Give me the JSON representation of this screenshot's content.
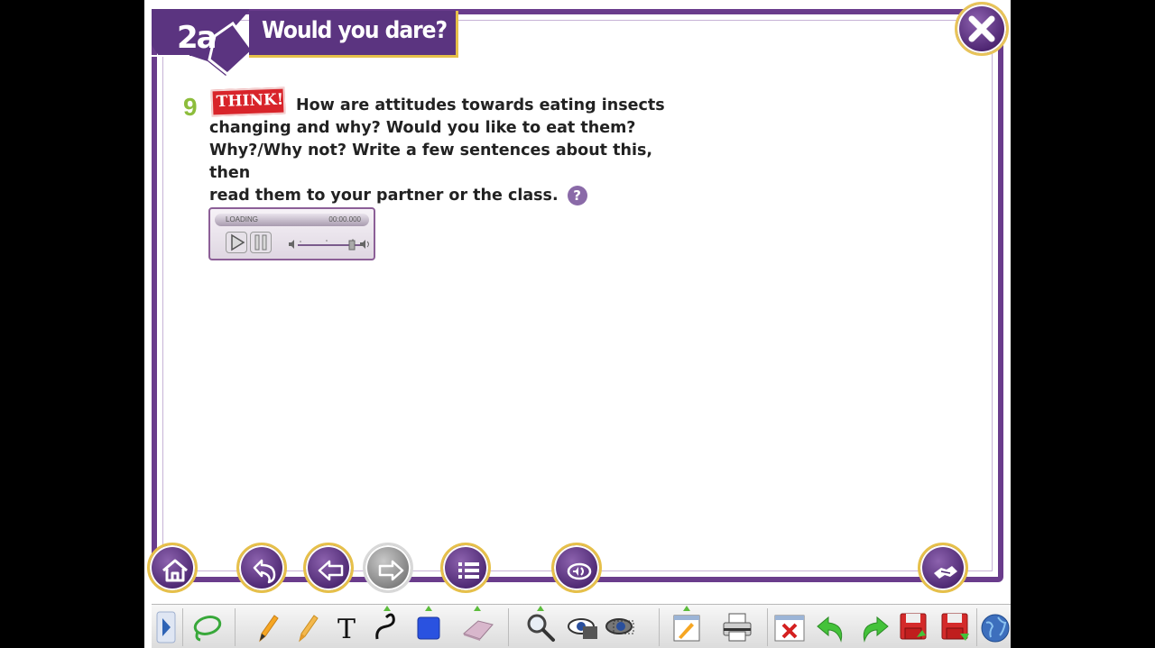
{
  "header": {
    "unit_number": "2a",
    "title": "Would you dare?"
  },
  "exercise": {
    "number": "9",
    "badge": "THINK!",
    "line1": "How are attitudes towards eating insects",
    "line2": "changing and why? Would you like to eat them?",
    "line3": "Why?/Why not? Write a few sentences about this, then",
    "line4": "read them to your partner or the class.",
    "help_icon_label": "?"
  },
  "audio_player": {
    "status": "LOADING",
    "time": "00:00.000",
    "volume_level": 1.0
  },
  "icons": {
    "close": "close-icon",
    "home": "home-icon",
    "back": "back-icon",
    "prev": "arrow-left-icon",
    "next": "arrow-right-icon",
    "menu": "list-icon",
    "audio": "speaker-icon",
    "handshake": "handshake-icon"
  },
  "colors": {
    "frame": "#6a3c8c",
    "accent_gold": "#e6c04a",
    "exercise_number": "#8dbd3c",
    "badge_red": "#d8242a"
  }
}
